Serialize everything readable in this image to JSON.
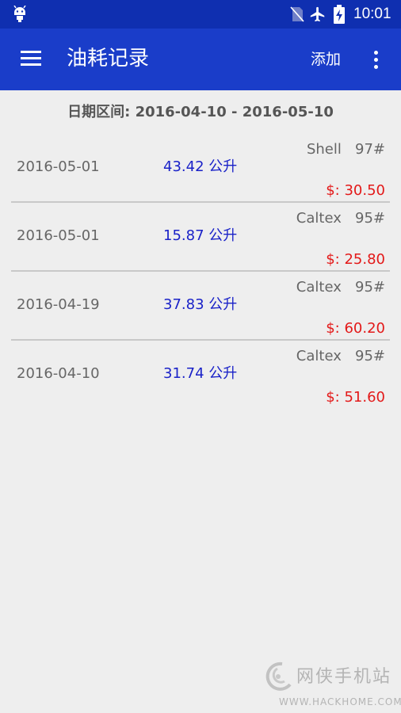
{
  "status_bar": {
    "time": "10:01",
    "icons": [
      "android-debug-icon",
      "no-sim-icon",
      "airplane-mode-icon",
      "battery-charging-icon"
    ]
  },
  "toolbar": {
    "title": "油耗记录",
    "add_label": "添加",
    "icons": [
      "menu-icon",
      "more-vert-icon"
    ],
    "background": "#1a3dc9"
  },
  "date_range": {
    "label": "日期区间: 2016-04-10 - 2016-05-10"
  },
  "records": [
    {
      "date": "2016-05-01",
      "volume": "43.42 公升",
      "station": "Shell   97#",
      "cost": "$: 30.50"
    },
    {
      "date": "2016-05-01",
      "volume": "15.87 公升",
      "station": "Caltex   95#",
      "cost": "$: 25.80"
    },
    {
      "date": "2016-04-19",
      "volume": "37.83 公升",
      "station": "Caltex   95#",
      "cost": "$: 60.20"
    },
    {
      "date": "2016-04-10",
      "volume": "31.74 公升",
      "station": "Caltex   95#",
      "cost": "$: 51.60"
    }
  ],
  "colors": {
    "volume": "#1a22c8",
    "cost": "#e31919",
    "status_bar": "#0f2fb0"
  },
  "watermark": {
    "text": "网侠手机站",
    "url": "WWW.HACKHOME.COM"
  }
}
